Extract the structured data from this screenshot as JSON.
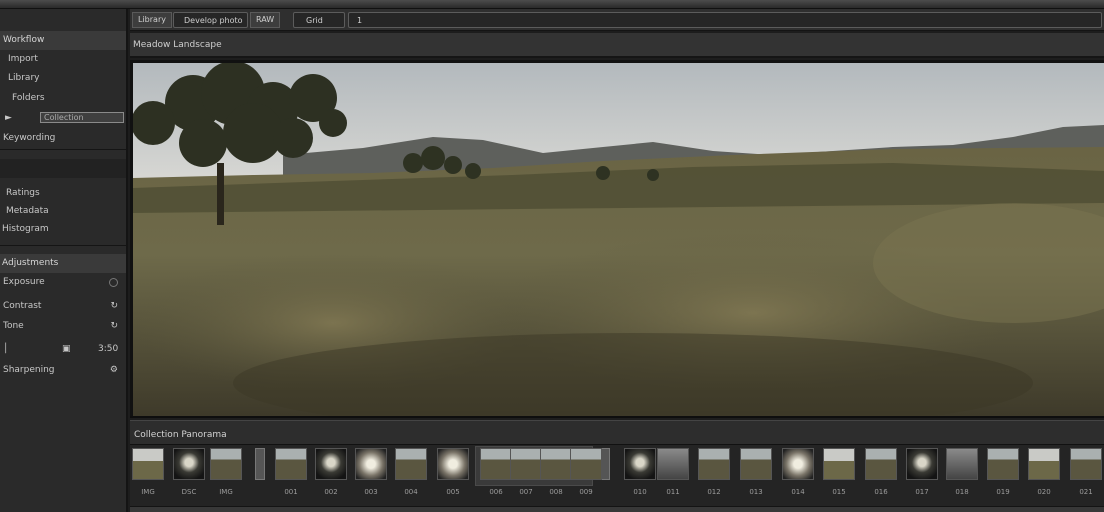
{
  "left_panel": {
    "rows": [
      {
        "label": "Workflow",
        "style": "head"
      },
      {
        "label": "Import",
        "style": "plain"
      },
      {
        "label": "Library",
        "style": "plain"
      },
      {
        "label": "Folders",
        "style": "plain"
      },
      {
        "label": "Collection",
        "style": "input"
      },
      {
        "label": "Keywording",
        "style": "plain"
      },
      {
        "label": "",
        "style": "dark"
      },
      {
        "label": "Ratings",
        "style": "plain"
      },
      {
        "label": "Metadata",
        "style": "plain"
      },
      {
        "label": "Histogram",
        "style": "plain"
      },
      {
        "label": "Adjustments",
        "style": "head"
      },
      {
        "label": "Exposure",
        "style": "plain"
      },
      {
        "label": "Contrast",
        "style": "plain"
      },
      {
        "label": "Tone",
        "style": "plain"
      },
      {
        "label": "Sharpening",
        "style": "plain"
      }
    ],
    "tone_value": "3:50"
  },
  "toolbar": {
    "mode_label": "Library",
    "search_value": "Develop photo",
    "raw_label": "RAW",
    "view_label": "Grid",
    "count_label": "1"
  },
  "title": "Meadow Landscape",
  "filmstrip": {
    "header": "Collection Panorama",
    "thumbs": [
      {
        "label": "IMG",
        "tone": "sky"
      },
      {
        "label": "DSC",
        "tone": "dark"
      },
      {
        "label": "IMG",
        "tone": "field"
      },
      {
        "label": "001",
        "tone": "field"
      },
      {
        "label": "002",
        "tone": "dark"
      },
      {
        "label": "003",
        "tone": "glow"
      },
      {
        "label": "004",
        "tone": "field"
      },
      {
        "label": "005",
        "tone": "glow"
      },
      {
        "label": "006",
        "tone": "field"
      },
      {
        "label": "007",
        "tone": "field"
      },
      {
        "label": "008",
        "tone": "field"
      },
      {
        "label": "009",
        "tone": "field"
      },
      {
        "label": "010",
        "tone": "dark"
      },
      {
        "label": "011",
        "tone": "gray"
      },
      {
        "label": "012",
        "tone": "field"
      },
      {
        "label": "013",
        "tone": "field"
      },
      {
        "label": "014",
        "tone": "glow"
      },
      {
        "label": "015",
        "tone": "sky"
      },
      {
        "label": "016",
        "tone": "field"
      },
      {
        "label": "017",
        "tone": "dark"
      },
      {
        "label": "018",
        "tone": "gray"
      },
      {
        "label": "019",
        "tone": "field"
      },
      {
        "label": "020",
        "tone": "sky"
      },
      {
        "label": "021",
        "tone": "field"
      }
    ]
  },
  "colors": {
    "panel": "#2a2a2a",
    "accent": "#8a8a8a"
  }
}
